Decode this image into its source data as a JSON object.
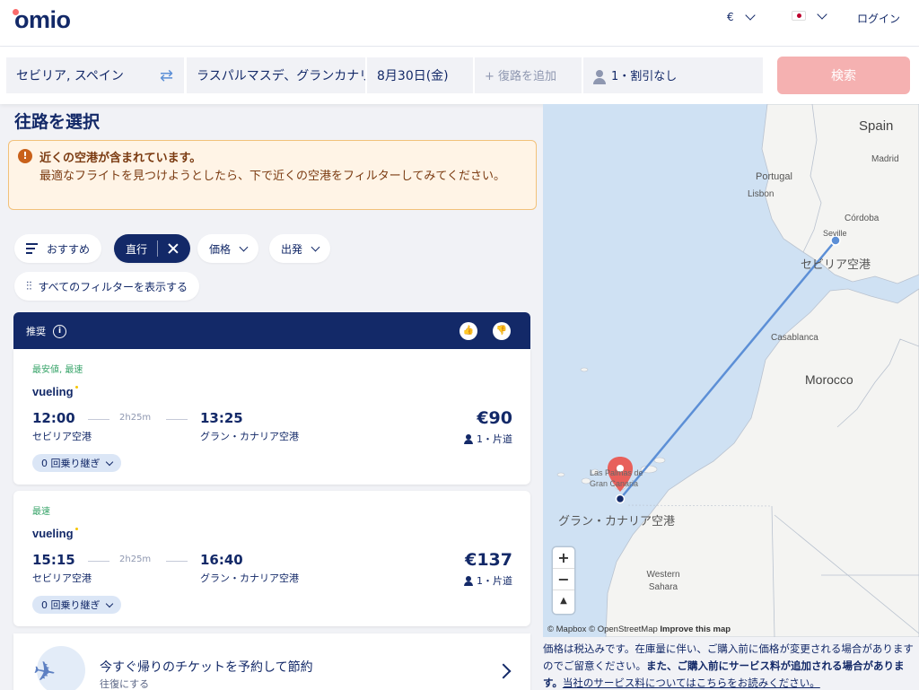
{
  "header": {
    "logo": "omio",
    "currency": "€",
    "login": "ログイン"
  },
  "search": {
    "origin": "セビリア, スペイン",
    "destination": "ラスパルマスデ、グランカナリア",
    "date": "8月30日(金)",
    "return_placeholder": "+ 復路を追加",
    "passengers": "1・割引なし",
    "search_button": "検索"
  },
  "main": {
    "title": "往路を選択",
    "notice_title": "近くの空港が含まれています。",
    "notice_body": "最適なフライトを見つけようとしたら、下で近くの空港をフィルターしてみてください。"
  },
  "filters": {
    "recommended": "おすすめ",
    "direct": "直行",
    "price": "価格",
    "departure": "出発",
    "all_filters": "すべてのフィルターを表示する"
  },
  "list_header": {
    "recommended_label": "推奨"
  },
  "results": [
    {
      "tags": "最安値, 最速",
      "airline": "vueling",
      "dep_time": "12:00",
      "duration": "2h25m",
      "arr_time": "13:25",
      "dep_station": "セビリア空港",
      "arr_station": "グラン・カナリア空港",
      "price": "€90",
      "pax": "1・片道",
      "stops": "0 回乗り継ぎ"
    },
    {
      "tags": "最速",
      "airline": "vueling",
      "dep_time": "15:15",
      "duration": "2h25m",
      "arr_time": "16:40",
      "dep_station": "セビリア空港",
      "arr_station": "グラン・カナリア空港",
      "price": "€137",
      "pax": "1・片道",
      "stops": "0 回乗り継ぎ"
    }
  ],
  "promo": {
    "title": "今すぐ帰りのチケットを予約して節約",
    "subtitle": "往復にする"
  },
  "map": {
    "labels": {
      "spain": "Spain",
      "madrid": "Madrid",
      "portugal": "Portugal",
      "lisbon": "Lisbon",
      "cordoba": "Córdoba",
      "seville": "Seville",
      "seville_airport": "セビリア空港",
      "casablanca": "Casablanca",
      "morocco": "Morocco",
      "las_palmas": "Las Palmas de Gran Canaria",
      "gc_airport": "グラン・カナリア空港",
      "western_sahara": "Western Sahara"
    },
    "zoom_in": "+",
    "zoom_out": "−",
    "compass": "▲",
    "attribution_1": "© Mapbox © OpenStreetMap",
    "attribution_2": "Improve this map",
    "colors": {
      "water": "#cfe1f3",
      "land": "#f4f4f2",
      "route": "#5c8fd6",
      "pin": "#e8605b"
    }
  },
  "disclaimer": {
    "part1": "価格は税込みです。在庫量に伴い、ご購入前に価格が変更される場合がありますのでご留意ください。",
    "part2": "また、ご購入前にサービス料が追加される場合があります。",
    "part3": "当社のサービス料についてはこちらをお読みください。"
  }
}
